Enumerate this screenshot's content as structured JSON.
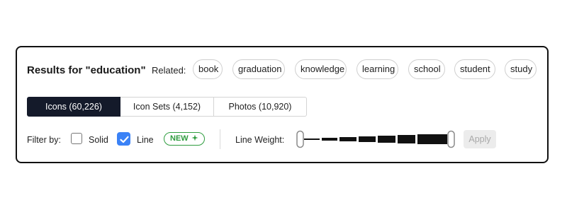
{
  "results": {
    "title": "Results for \"education\"",
    "related_label": "Related:",
    "related_tags": [
      "book",
      "graduation",
      "knowledge",
      "learning",
      "school",
      "student",
      "study"
    ]
  },
  "tabs": [
    {
      "label": "Icons (60,226)",
      "active": true
    },
    {
      "label": "Icon Sets (4,152)",
      "active": false
    },
    {
      "label": "Photos (10,920)",
      "active": false
    }
  ],
  "filter": {
    "label": "Filter by:",
    "options": [
      {
        "label": "Solid",
        "checked": false
      },
      {
        "label": "Line",
        "checked": true
      }
    ],
    "new_badge": "NEW",
    "new_badge_icon": "sparkle-icon"
  },
  "line_weight": {
    "label": "Line Weight:",
    "min": 0,
    "max": 1,
    "selected_range": [
      0,
      1
    ],
    "steps": 7
  },
  "apply_button": {
    "label": "Apply",
    "enabled": false
  },
  "colors": {
    "active_tab_bg": "#141a2a",
    "checkbox_checked": "#3b82f6",
    "new_badge": "#2e9c3e",
    "apply_disabled_bg": "#ececec"
  }
}
